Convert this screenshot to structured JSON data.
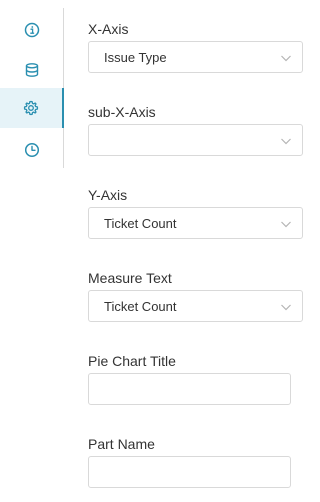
{
  "sidebar": {
    "items": [
      {
        "icon": "info-icon",
        "active": false
      },
      {
        "icon": "database-icon",
        "active": false
      },
      {
        "icon": "gear-icon",
        "active": true
      },
      {
        "icon": "clock-icon",
        "active": false
      }
    ],
    "accent_color": "#2a8fb0",
    "active_bg": "#e6f3f8"
  },
  "form": {
    "x_axis": {
      "label": "X-Axis",
      "value": "Issue Type"
    },
    "sub_x_axis": {
      "label": "sub-X-Axis",
      "value": ""
    },
    "y_axis": {
      "label": "Y-Axis",
      "value": "Ticket Count"
    },
    "measure_text": {
      "label": "Measure Text",
      "value": "Ticket Count"
    },
    "pie_chart_title": {
      "label": "Pie Chart Title",
      "value": ""
    },
    "part_name": {
      "label": "Part Name",
      "value": ""
    }
  }
}
